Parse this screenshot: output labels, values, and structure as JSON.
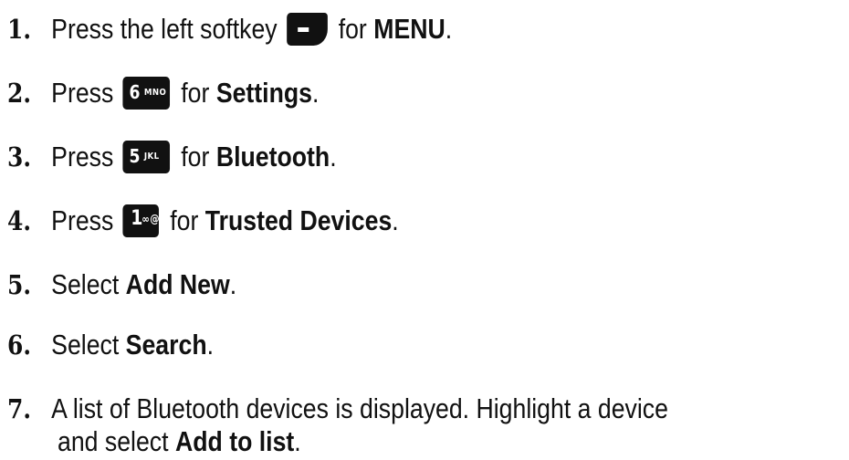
{
  "steps": [
    {
      "num": "1.",
      "pre": "Press the left softkey",
      "key_glyph": "–",
      "post": "for",
      "bold": "MENU",
      "end": "."
    },
    {
      "num": "2.",
      "pre": "Press",
      "key_big": "6",
      "key_small": "MNO",
      "post": "for",
      "bold": "Settings",
      "end": "."
    },
    {
      "num": "3.",
      "pre": "Press",
      "key_big": "5",
      "key_small": "JKL",
      "post": "for",
      "bold": "Bluetooth",
      "end": "."
    },
    {
      "num": "4.",
      "pre": "Press",
      "key_big": "1",
      "key_small": "∞@",
      "post": "for",
      "bold": "Trusted Devices",
      "end": "."
    },
    {
      "num": "5.",
      "pre": "Select",
      "bold": "Add New",
      "end": "."
    },
    {
      "num": "6.",
      "pre": "Select",
      "bold": "Search",
      "end": "."
    },
    {
      "num": "7.",
      "pre": "A list of Bluetooth devices is displayed. Highlight a device",
      "cont_pre": "and select",
      "bold": "Add to list",
      "end": "."
    }
  ]
}
